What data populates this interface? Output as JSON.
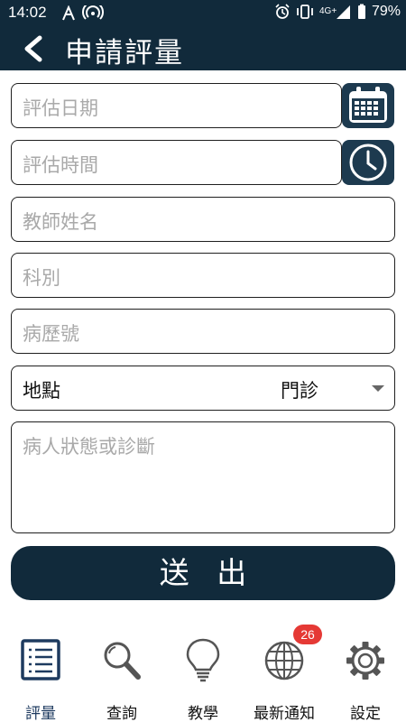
{
  "status_bar": {
    "time": "14:02",
    "battery": "79%",
    "network": "4G+"
  },
  "header": {
    "title": "申請評量"
  },
  "form": {
    "date_placeholder": "評估日期",
    "time_placeholder": "評估時間",
    "teacher_placeholder": "教師姓名",
    "department_placeholder": "科別",
    "record_placeholder": "病歷號",
    "location_label": "地點",
    "location_value": "門診",
    "status_placeholder": "病人狀態或診斷",
    "submit_label": "送 出"
  },
  "tabs": [
    {
      "label": "評量",
      "icon": "list-icon"
    },
    {
      "label": "查詢",
      "icon": "search-icon"
    },
    {
      "label": "教學",
      "icon": "lightbulb-icon"
    },
    {
      "label": "最新通知",
      "icon": "globe-icon",
      "badge": "26"
    },
    {
      "label": "設定",
      "icon": "gear-icon"
    }
  ],
  "colors": {
    "primary": "#112a3b",
    "accent_button": "#1d3a4f",
    "badge": "#e53935"
  }
}
